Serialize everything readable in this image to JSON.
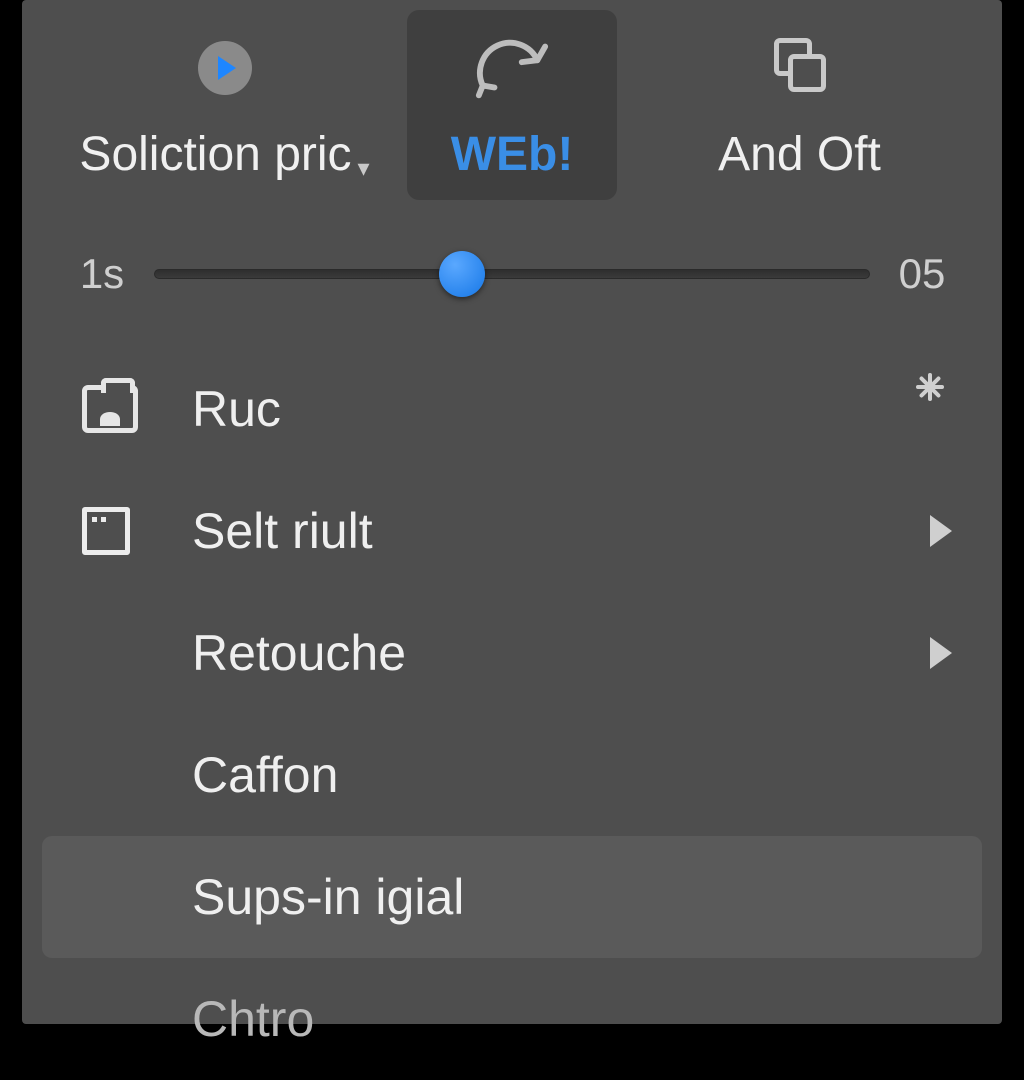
{
  "tabs": [
    {
      "label": "Soliction pric"
    },
    {
      "label": "WEb!"
    },
    {
      "label": "And Oft"
    }
  ],
  "slider": {
    "left": "1s",
    "right": "05"
  },
  "rows": [
    {
      "title": "Ruc"
    },
    {
      "title": "Selt riult"
    },
    {
      "title": "Retouche"
    },
    {
      "title": "Caffon"
    },
    {
      "title": "Sups-in igial"
    },
    {
      "title": "Chtro"
    }
  ]
}
